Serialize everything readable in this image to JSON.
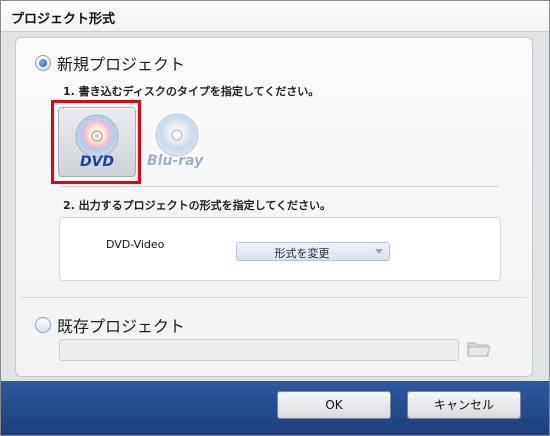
{
  "window": {
    "title": "プロジェクト形式"
  },
  "new_project": {
    "label": "新規プロジェクト",
    "selected": true,
    "step1": "1. 書き込むディスクのタイプを指定してください。",
    "discs": [
      {
        "name": "DVD",
        "selected": true,
        "icon": "dvd-disc-icon"
      },
      {
        "name": "Blu-ray",
        "selected": false,
        "icon": "bluray-disc-icon"
      }
    ],
    "step2": "2. 出力するプロジェクトの形式を指定してください。",
    "format": {
      "name": "DVD-Video",
      "change_label": "形式を変更"
    }
  },
  "existing_project": {
    "label": "既存プロジェクト",
    "selected": false,
    "path_value": ""
  },
  "buttons": {
    "ok": "OK",
    "cancel": "キャンセル"
  },
  "colors": {
    "highlight": "#e60012",
    "footer": "#24498a"
  }
}
